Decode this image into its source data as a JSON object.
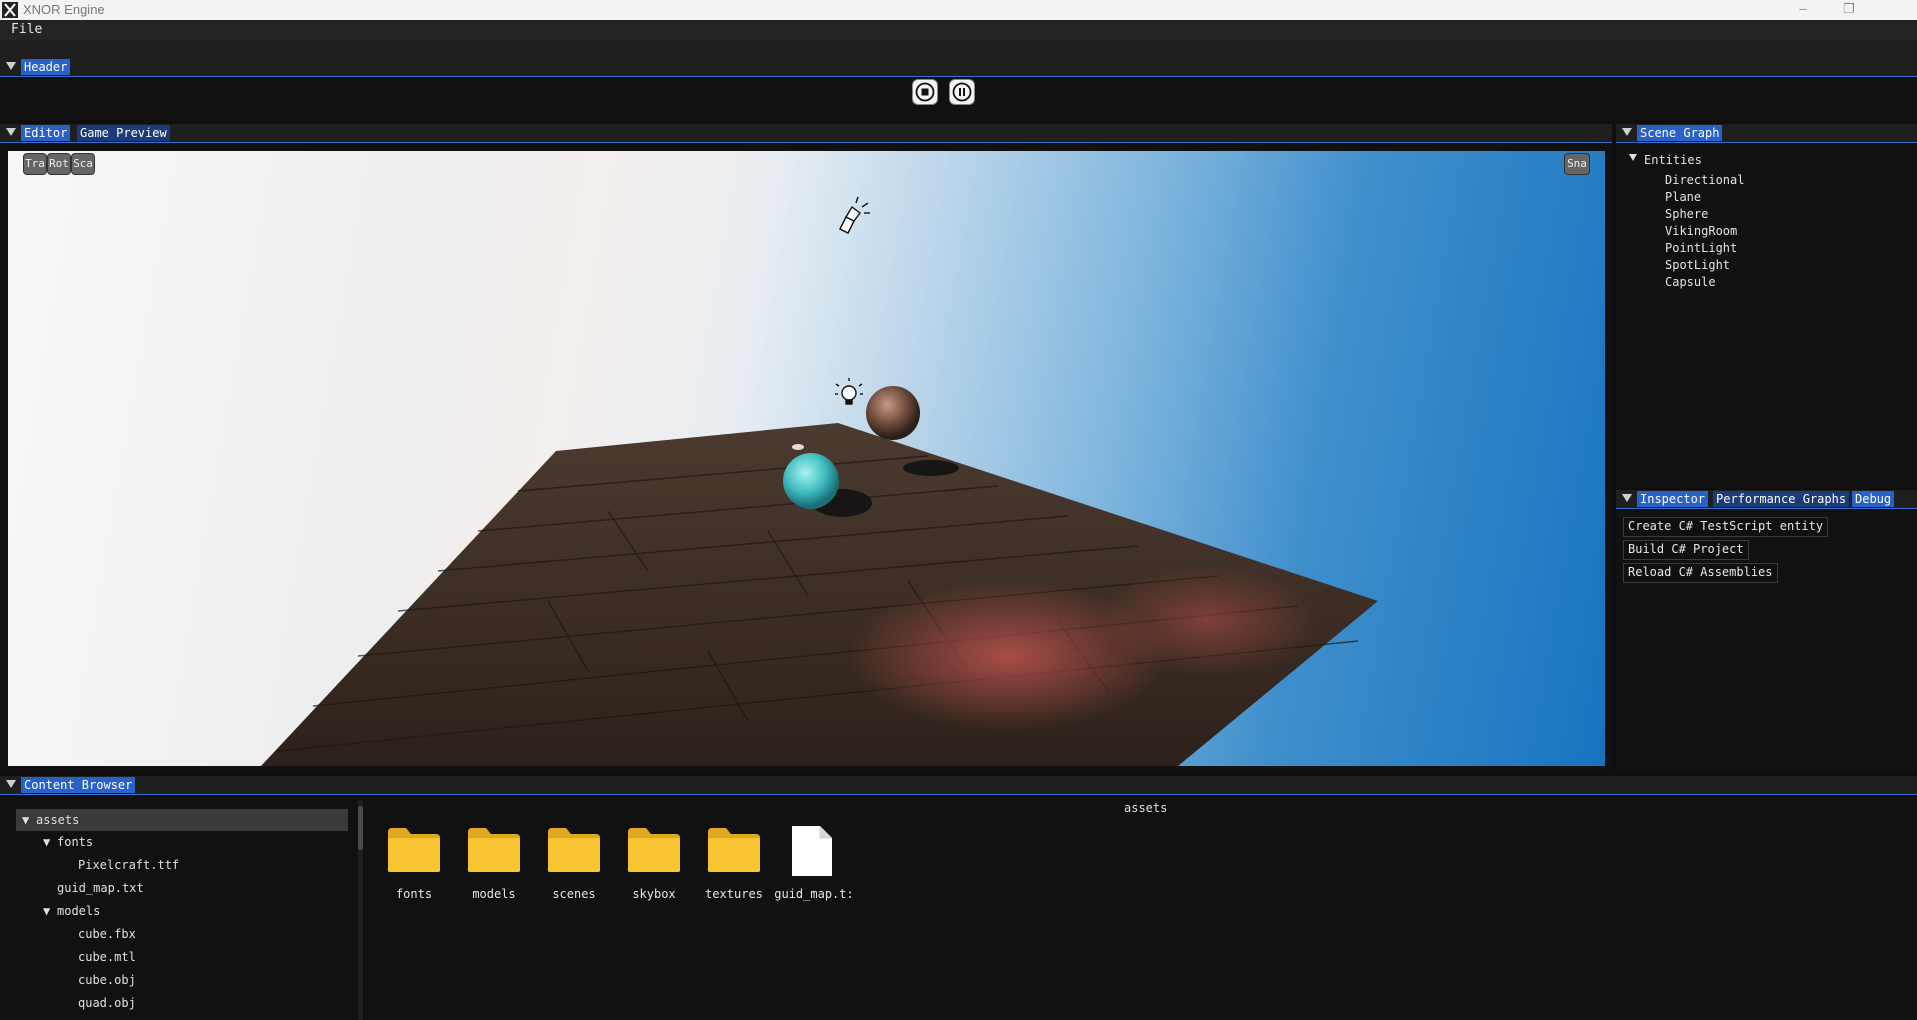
{
  "window": {
    "title": "XNOR Engine",
    "minimize_icon": "minimize-icon",
    "restore_icon": "restore-icon"
  },
  "menubar": {
    "file": "File"
  },
  "header_panel": {
    "tab": "Header",
    "stop_icon": "stop-icon",
    "pause_icon": "pause-icon"
  },
  "editor_panel": {
    "tabs": [
      "Editor",
      "Game Preview"
    ],
    "tool_buttons": [
      "Tra",
      "Rot",
      "Sca"
    ],
    "snap_button": "Sna"
  },
  "scene_graph": {
    "tab": "Scene Graph",
    "root": "Entities",
    "entities": [
      "Directional",
      "Plane",
      "Sphere",
      "VikingRoom",
      "PointLight",
      "SpotLight",
      "Capsule"
    ]
  },
  "inspector": {
    "tabs": [
      "Inspector",
      "Performance Graphs",
      "Debug"
    ],
    "buttons": [
      "Create C# TestScript entity",
      "Build C# Project",
      "Reload C# Assemblies"
    ]
  },
  "content_browser": {
    "tab": "Content Browser",
    "current_folder": "assets",
    "tree": [
      {
        "label": "assets",
        "level": 0,
        "expanded": true,
        "selected": true
      },
      {
        "label": "fonts",
        "level": 1,
        "expanded": true
      },
      {
        "label": "Pixelcraft.ttf",
        "level": 2
      },
      {
        "label": "guid_map.txt",
        "level": 1
      },
      {
        "label": "models",
        "level": 1,
        "expanded": true
      },
      {
        "label": "cube.fbx",
        "level": 2
      },
      {
        "label": "cube.mtl",
        "level": 2
      },
      {
        "label": "cube.obj",
        "level": 2
      },
      {
        "label": "quad.obj",
        "level": 2
      }
    ],
    "items": [
      {
        "label": "fonts",
        "icon": "folder-icon"
      },
      {
        "label": "models",
        "icon": "folder-icon"
      },
      {
        "label": "scenes",
        "icon": "folder-icon"
      },
      {
        "label": "skybox",
        "icon": "folder-icon"
      },
      {
        "label": "textures",
        "icon": "folder-icon"
      },
      {
        "label": "guid_map.t:",
        "icon": "file-icon"
      }
    ]
  },
  "colors": {
    "accent": "#2862c8",
    "folder": "#f6c12e",
    "background": "#111111"
  }
}
